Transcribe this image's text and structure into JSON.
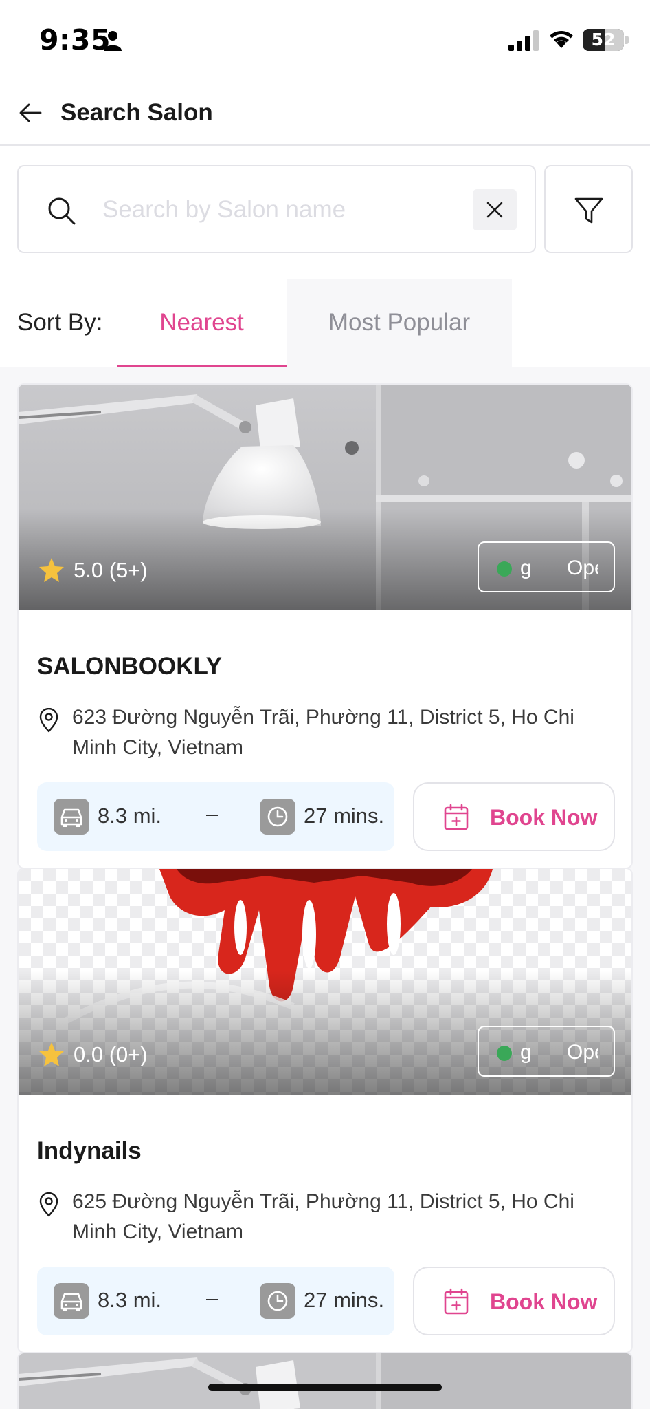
{
  "status_bar": {
    "time": "9:35",
    "battery_level": "52",
    "battery_fraction": 0.52
  },
  "header": {
    "title": "Search Salon"
  },
  "search": {
    "placeholder": "Search by Salon name",
    "value": ""
  },
  "sort": {
    "label": "Sort By:",
    "tabs": [
      {
        "label": "Nearest",
        "active": true
      },
      {
        "label": "Most Popular",
        "active": false
      }
    ]
  },
  "salons": [
    {
      "name": "SALONBOOKLY",
      "rating": "5.0 (5+)",
      "status_part1": "g",
      "status_part2": "Ope",
      "address": "623 Đường Nguyễn Trãi, Phường 11, District 5, Ho Chi Minh City, Vietnam",
      "distance": "8.3 mi.",
      "separator": "–",
      "duration": "27 mins.",
      "book_label": "Book Now",
      "image": "lamp-photo"
    },
    {
      "name": "Indynails",
      "rating": "0.0 (0+)",
      "status_part1": "g",
      "status_part2": "Ope",
      "address": "625 Đường Nguyễn Trãi, Phường 11, District 5, Ho Chi Minh City, Vietnam",
      "distance": "8.3 mi.",
      "separator": "–",
      "duration": "27 mins.",
      "book_label": "Book Now",
      "image": "red-nails-logo"
    }
  ],
  "colors": {
    "accent": "#e0458f",
    "open_dot": "#3aa858",
    "star": "#f6c23e",
    "info_bg": "#eef7ff"
  },
  "icons": [
    "person-icon",
    "signal-icon",
    "wifi-icon",
    "battery-icon",
    "back-arrow-icon",
    "search-icon",
    "close-icon",
    "filter-icon",
    "star-icon",
    "location-pin-icon",
    "car-icon",
    "clock-icon",
    "calendar-plus-icon"
  ]
}
